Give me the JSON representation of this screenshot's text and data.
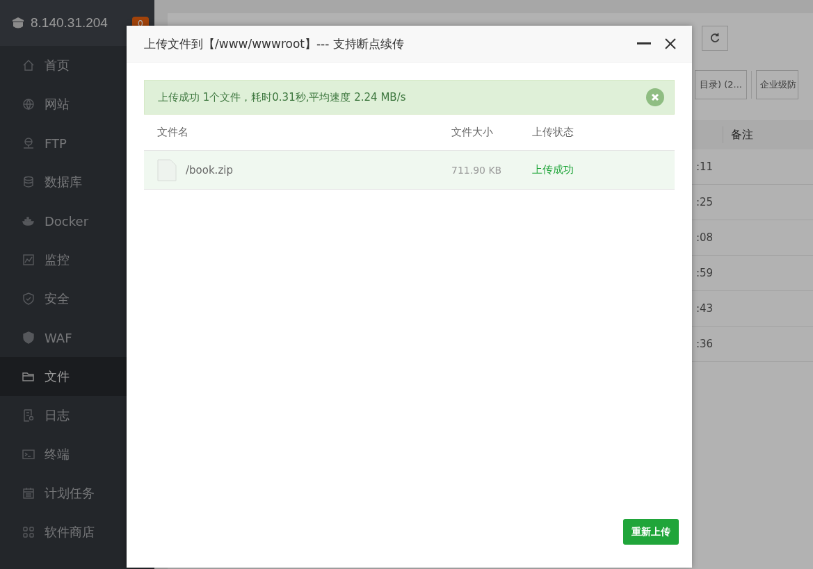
{
  "sidebar": {
    "host": "8.140.31.204",
    "badge": "0",
    "items": [
      {
        "label": "首页",
        "selected": false
      },
      {
        "label": "网站",
        "selected": false
      },
      {
        "label": "FTP",
        "selected": false
      },
      {
        "label": "数据库",
        "selected": false
      },
      {
        "label": "Docker",
        "selected": false
      },
      {
        "label": "监控",
        "selected": false
      },
      {
        "label": "安全",
        "selected": false
      },
      {
        "label": "WAF",
        "selected": false
      },
      {
        "label": "文件",
        "selected": true
      },
      {
        "label": "日志",
        "selected": false
      },
      {
        "label": "终端",
        "selected": false
      },
      {
        "label": "计划任务",
        "selected": false
      },
      {
        "label": "软件商店",
        "selected": false
      }
    ]
  },
  "background": {
    "buttons": [
      "目录) (2...",
      "企业级防"
    ],
    "column": "备注",
    "rows": [
      ":11",
      ":25",
      ":08",
      ":59",
      ":43",
      ":36"
    ]
  },
  "dialog": {
    "title": "上传文件到【/www/wwwroot】--- 支持断点续传",
    "alert": "上传成功 1个文件，耗时0.31秒,平均速度 2.24 MB/s",
    "columns": [
      "文件名",
      "文件大小",
      "上传状态"
    ],
    "files": [
      {
        "name": "/book.zip",
        "size": "711.90 KB",
        "status": "上传成功"
      }
    ],
    "button": "重新上传"
  }
}
